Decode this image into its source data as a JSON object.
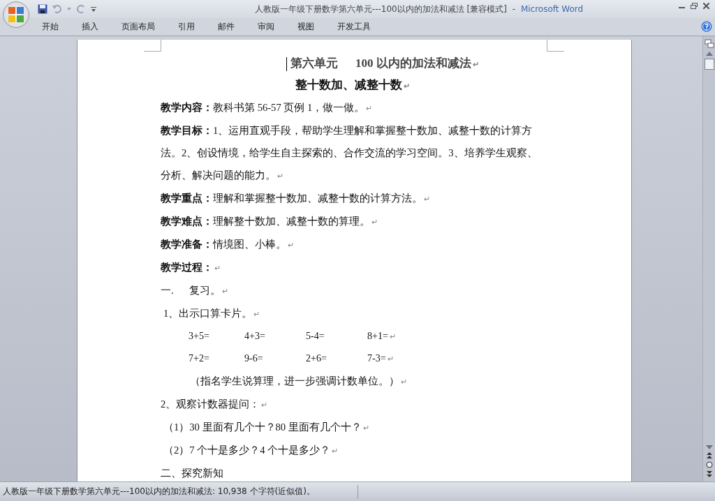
{
  "window": {
    "title": "人教版一年级下册数学第六单元---100以内的加法和减法 [兼容模式]",
    "separator": "-",
    "app_name": "Microsoft Word"
  },
  "tabs": [
    {
      "label": "开始",
      "selected": false
    },
    {
      "label": "插入",
      "selected": false
    },
    {
      "label": "页面布局",
      "selected": false
    },
    {
      "label": "引用",
      "selected": false
    },
    {
      "label": "邮件",
      "selected": false
    },
    {
      "label": "审阅",
      "selected": false
    },
    {
      "label": "视图",
      "selected": false
    },
    {
      "label": "开发工具",
      "selected": false
    }
  ],
  "document": {
    "lines": [
      {
        "kind": "title",
        "text": "第六单元      100 以内的加法和减法",
        "end": "↵"
      },
      {
        "kind": "subtitle",
        "text": "整十数加、减整十数",
        "end": "↵"
      },
      {
        "kind": "para",
        "text": "**教学内容：**教科书第 56-57 页例 1，做一做。",
        "end": "↵"
      },
      {
        "kind": "para",
        "text": "**教学目标：**1、运用直观手段，帮助学生理解和掌握整十数加、减整十数的计算方法。2、创设情境，给学生自主探索的、合作交流的学习空间。3、培养学生观察、分析、解决问题的能力。",
        "end": "↵"
      },
      {
        "kind": "para",
        "text": "**教学重点：**理解和掌握整十数加、减整十数的计算方法。",
        "end": "↵"
      },
      {
        "kind": "para",
        "text": "**教学难点：**理解整十数加、减整十数的算理。",
        "end": "↵"
      },
      {
        "kind": "para",
        "text": "**教学准备：**情境图、小棒。",
        "end": "↵"
      },
      {
        "kind": "para",
        "text": "**教学过程：**",
        "end": "↵"
      },
      {
        "kind": "section",
        "text": "一.      复习。",
        "end": "↵"
      },
      {
        "kind": "item",
        "text": "1、出示口算卡片。",
        "end": "↵"
      },
      {
        "kind": "equations",
        "items": [
          "3+5=",
          "4+3=",
          "5-4=",
          "8+1="
        ],
        "end": "↵"
      },
      {
        "kind": "equations",
        "items": [
          "7+2=",
          "9-6=",
          "2+6=",
          "7-3="
        ],
        "end": "↵"
      },
      {
        "kind": "note",
        "text": "（指名学生说算理，进一步强调计数单位。）",
        "end": "↵"
      },
      {
        "kind": "para",
        "text": "2、观察计数器提问：",
        "end": "↵"
      },
      {
        "kind": "item",
        "text": "（1）30 里面有几个十？80 里面有几个十？",
        "end": "↵"
      },
      {
        "kind": "item",
        "text": "（2）7 个十是多少？4 个十是多少？",
        "end": "↵"
      },
      {
        "kind": "section",
        "text": "二、探究新知"
      }
    ]
  },
  "status_bar": {
    "text": "人教版一年级下册数学第六单元---100以内的加法和减法: 10,938 个字符(近似值)。"
  }
}
